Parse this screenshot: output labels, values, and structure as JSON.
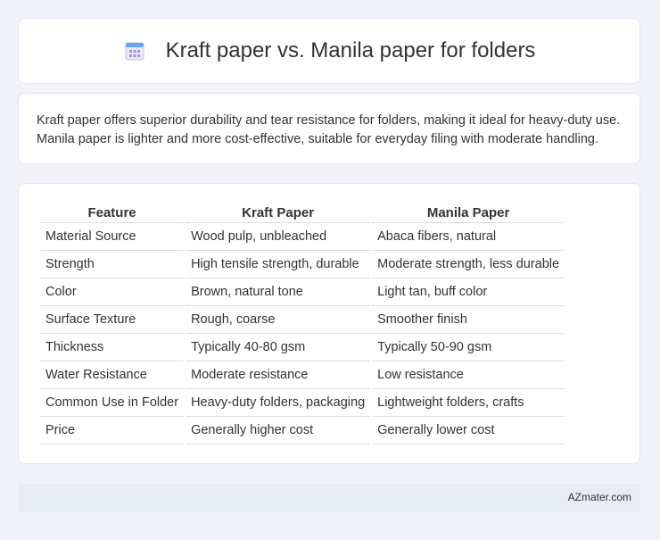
{
  "header": {
    "title": "Kraft paper vs. Manila paper for folders",
    "icon": "calendar-icon"
  },
  "description": {
    "text": "Kraft paper offers superior durability and tear resistance for folders, making it ideal for heavy-duty use. Manila paper is lighter and more cost-effective, suitable for everyday filing with moderate handling."
  },
  "table": {
    "headers": [
      "Feature",
      "Kraft Paper",
      "Manila Paper"
    ],
    "rows": [
      [
        "Material Source",
        "Wood pulp, unbleached",
        "Abaca fibers, natural"
      ],
      [
        "Strength",
        "High tensile strength, durable",
        "Moderate strength, less durable"
      ],
      [
        "Color",
        "Brown, natural tone",
        "Light tan, buff color"
      ],
      [
        "Surface Texture",
        "Rough, coarse",
        "Smoother finish"
      ],
      [
        "Thickness",
        "Typically 40-80 gsm",
        "Typically 50-90 gsm"
      ],
      [
        "Water Resistance",
        "Moderate resistance",
        "Low resistance"
      ],
      [
        "Common Use in Folder",
        "Heavy-duty folders, packaging",
        "Lightweight folders, crafts"
      ],
      [
        "Price",
        "Generally higher cost",
        "Generally lower cost"
      ]
    ]
  },
  "footer": {
    "brand": "AZmater.com"
  },
  "colors": {
    "background": "#f1f3f9",
    "card": "#ffffff",
    "footer": "#e8ecf7",
    "icon_accent": "#8a7fe0"
  }
}
